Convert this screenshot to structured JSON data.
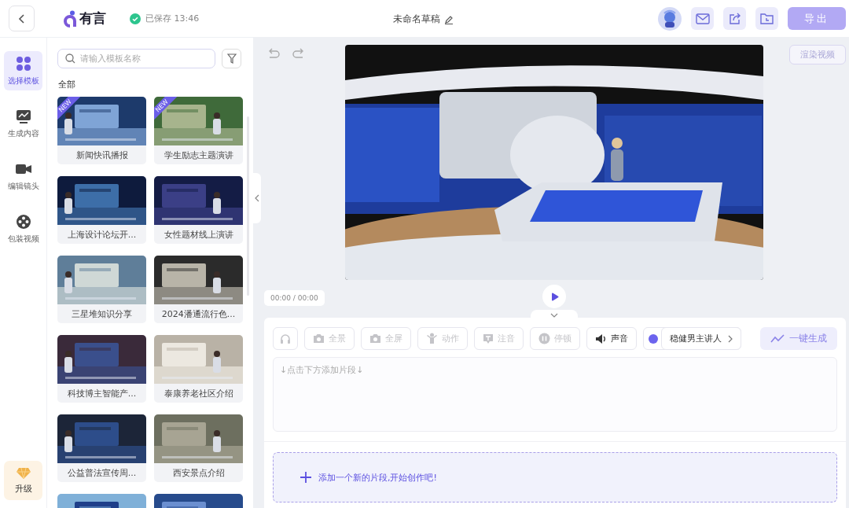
{
  "header": {
    "logo_text": "有言",
    "save_status": "已保存 13:46",
    "title": "未命名草稿",
    "export_button": "导出"
  },
  "nav": {
    "items": [
      {
        "label": "选择模板",
        "selected": true
      },
      {
        "label": "生成内容",
        "selected": false
      },
      {
        "label": "编辑镜头",
        "selected": false
      },
      {
        "label": "包装视频",
        "selected": false
      }
    ],
    "upgrade": "升级"
  },
  "templates": {
    "search": {
      "placeholder": "请输入模板名称"
    },
    "category": "全部",
    "items": [
      {
        "title": "新闻快讯播报",
        "badge": "NEW"
      },
      {
        "title": "学生励志主题演讲",
        "badge": "NEW"
      },
      {
        "title": "上海设计论坛开..."
      },
      {
        "title": "女性题材线上演讲"
      },
      {
        "title": "三星堆知识分享"
      },
      {
        "title": "2024潘通流行色..."
      },
      {
        "title": "科技博主智能产..."
      },
      {
        "title": "泰康养老社区介绍"
      },
      {
        "title": "公益普法宣传周..."
      },
      {
        "title": "西安景点介绍"
      },
      {
        "kind": "picture"
      },
      {
        "kind": "picture"
      }
    ]
  },
  "preview": {
    "render_button": "渲染视频",
    "time": "00:00 / 00:00"
  },
  "editor": {
    "tools": [
      {
        "kind": "headphones",
        "disabled": true
      },
      {
        "kind": "camera",
        "label": "全景",
        "disabled": true
      },
      {
        "kind": "camera",
        "label": "全屏",
        "disabled": true
      },
      {
        "kind": "person",
        "label": "动作",
        "disabled": true
      },
      {
        "kind": "text",
        "label": "注音",
        "disabled": true
      },
      {
        "kind": "pause",
        "label": "停顿",
        "disabled": true
      },
      {
        "kind": "speaker",
        "label": "声音",
        "disabled": false
      }
    ],
    "voice": "稳健男主讲人",
    "generate_button": "一键生成",
    "script_placeholder": "↓点击下方添加片段↓",
    "add_segment": "添加一个新的片段,开始创作吧!"
  }
}
